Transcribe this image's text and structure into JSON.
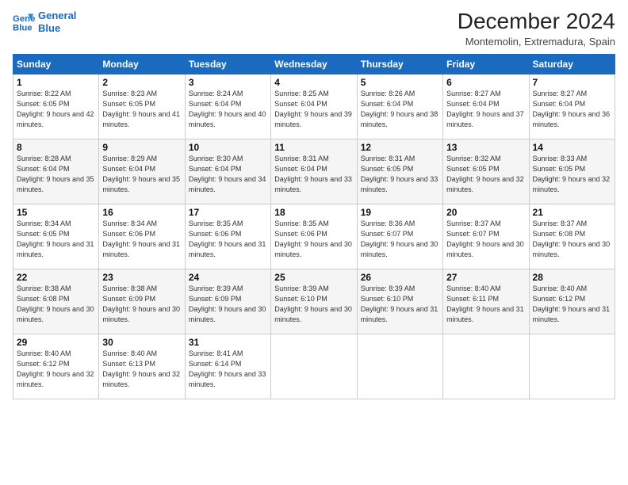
{
  "logo": {
    "line1": "General",
    "line2": "Blue"
  },
  "title": "December 2024",
  "subtitle": "Montemolin, Extremadura, Spain",
  "days_header": [
    "Sunday",
    "Monday",
    "Tuesday",
    "Wednesday",
    "Thursday",
    "Friday",
    "Saturday"
  ],
  "weeks": [
    [
      {
        "day": "1",
        "sunrise": "Sunrise: 8:22 AM",
        "sunset": "Sunset: 6:05 PM",
        "daylight": "Daylight: 9 hours and 42 minutes."
      },
      {
        "day": "2",
        "sunrise": "Sunrise: 8:23 AM",
        "sunset": "Sunset: 6:05 PM",
        "daylight": "Daylight: 9 hours and 41 minutes."
      },
      {
        "day": "3",
        "sunrise": "Sunrise: 8:24 AM",
        "sunset": "Sunset: 6:04 PM",
        "daylight": "Daylight: 9 hours and 40 minutes."
      },
      {
        "day": "4",
        "sunrise": "Sunrise: 8:25 AM",
        "sunset": "Sunset: 6:04 PM",
        "daylight": "Daylight: 9 hours and 39 minutes."
      },
      {
        "day": "5",
        "sunrise": "Sunrise: 8:26 AM",
        "sunset": "Sunset: 6:04 PM",
        "daylight": "Daylight: 9 hours and 38 minutes."
      },
      {
        "day": "6",
        "sunrise": "Sunrise: 8:27 AM",
        "sunset": "Sunset: 6:04 PM",
        "daylight": "Daylight: 9 hours and 37 minutes."
      },
      {
        "day": "7",
        "sunrise": "Sunrise: 8:27 AM",
        "sunset": "Sunset: 6:04 PM",
        "daylight": "Daylight: 9 hours and 36 minutes."
      }
    ],
    [
      {
        "day": "8",
        "sunrise": "Sunrise: 8:28 AM",
        "sunset": "Sunset: 6:04 PM",
        "daylight": "Daylight: 9 hours and 35 minutes."
      },
      {
        "day": "9",
        "sunrise": "Sunrise: 8:29 AM",
        "sunset": "Sunset: 6:04 PM",
        "daylight": "Daylight: 9 hours and 35 minutes."
      },
      {
        "day": "10",
        "sunrise": "Sunrise: 8:30 AM",
        "sunset": "Sunset: 6:04 PM",
        "daylight": "Daylight: 9 hours and 34 minutes."
      },
      {
        "day": "11",
        "sunrise": "Sunrise: 8:31 AM",
        "sunset": "Sunset: 6:04 PM",
        "daylight": "Daylight: 9 hours and 33 minutes."
      },
      {
        "day": "12",
        "sunrise": "Sunrise: 8:31 AM",
        "sunset": "Sunset: 6:05 PM",
        "daylight": "Daylight: 9 hours and 33 minutes."
      },
      {
        "day": "13",
        "sunrise": "Sunrise: 8:32 AM",
        "sunset": "Sunset: 6:05 PM",
        "daylight": "Daylight: 9 hours and 32 minutes."
      },
      {
        "day": "14",
        "sunrise": "Sunrise: 8:33 AM",
        "sunset": "Sunset: 6:05 PM",
        "daylight": "Daylight: 9 hours and 32 minutes."
      }
    ],
    [
      {
        "day": "15",
        "sunrise": "Sunrise: 8:34 AM",
        "sunset": "Sunset: 6:05 PM",
        "daylight": "Daylight: 9 hours and 31 minutes."
      },
      {
        "day": "16",
        "sunrise": "Sunrise: 8:34 AM",
        "sunset": "Sunset: 6:06 PM",
        "daylight": "Daylight: 9 hours and 31 minutes."
      },
      {
        "day": "17",
        "sunrise": "Sunrise: 8:35 AM",
        "sunset": "Sunset: 6:06 PM",
        "daylight": "Daylight: 9 hours and 31 minutes."
      },
      {
        "day": "18",
        "sunrise": "Sunrise: 8:35 AM",
        "sunset": "Sunset: 6:06 PM",
        "daylight": "Daylight: 9 hours and 30 minutes."
      },
      {
        "day": "19",
        "sunrise": "Sunrise: 8:36 AM",
        "sunset": "Sunset: 6:07 PM",
        "daylight": "Daylight: 9 hours and 30 minutes."
      },
      {
        "day": "20",
        "sunrise": "Sunrise: 8:37 AM",
        "sunset": "Sunset: 6:07 PM",
        "daylight": "Daylight: 9 hours and 30 minutes."
      },
      {
        "day": "21",
        "sunrise": "Sunrise: 8:37 AM",
        "sunset": "Sunset: 6:08 PM",
        "daylight": "Daylight: 9 hours and 30 minutes."
      }
    ],
    [
      {
        "day": "22",
        "sunrise": "Sunrise: 8:38 AM",
        "sunset": "Sunset: 6:08 PM",
        "daylight": "Daylight: 9 hours and 30 minutes."
      },
      {
        "day": "23",
        "sunrise": "Sunrise: 8:38 AM",
        "sunset": "Sunset: 6:09 PM",
        "daylight": "Daylight: 9 hours and 30 minutes."
      },
      {
        "day": "24",
        "sunrise": "Sunrise: 8:39 AM",
        "sunset": "Sunset: 6:09 PM",
        "daylight": "Daylight: 9 hours and 30 minutes."
      },
      {
        "day": "25",
        "sunrise": "Sunrise: 8:39 AM",
        "sunset": "Sunset: 6:10 PM",
        "daylight": "Daylight: 9 hours and 30 minutes."
      },
      {
        "day": "26",
        "sunrise": "Sunrise: 8:39 AM",
        "sunset": "Sunset: 6:10 PM",
        "daylight": "Daylight: 9 hours and 31 minutes."
      },
      {
        "day": "27",
        "sunrise": "Sunrise: 8:40 AM",
        "sunset": "Sunset: 6:11 PM",
        "daylight": "Daylight: 9 hours and 31 minutes."
      },
      {
        "day": "28",
        "sunrise": "Sunrise: 8:40 AM",
        "sunset": "Sunset: 6:12 PM",
        "daylight": "Daylight: 9 hours and 31 minutes."
      }
    ],
    [
      {
        "day": "29",
        "sunrise": "Sunrise: 8:40 AM",
        "sunset": "Sunset: 6:12 PM",
        "daylight": "Daylight: 9 hours and 32 minutes."
      },
      {
        "day": "30",
        "sunrise": "Sunrise: 8:40 AM",
        "sunset": "Sunset: 6:13 PM",
        "daylight": "Daylight: 9 hours and 32 minutes."
      },
      {
        "day": "31",
        "sunrise": "Sunrise: 8:41 AM",
        "sunset": "Sunset: 6:14 PM",
        "daylight": "Daylight: 9 hours and 33 minutes."
      },
      null,
      null,
      null,
      null
    ]
  ]
}
